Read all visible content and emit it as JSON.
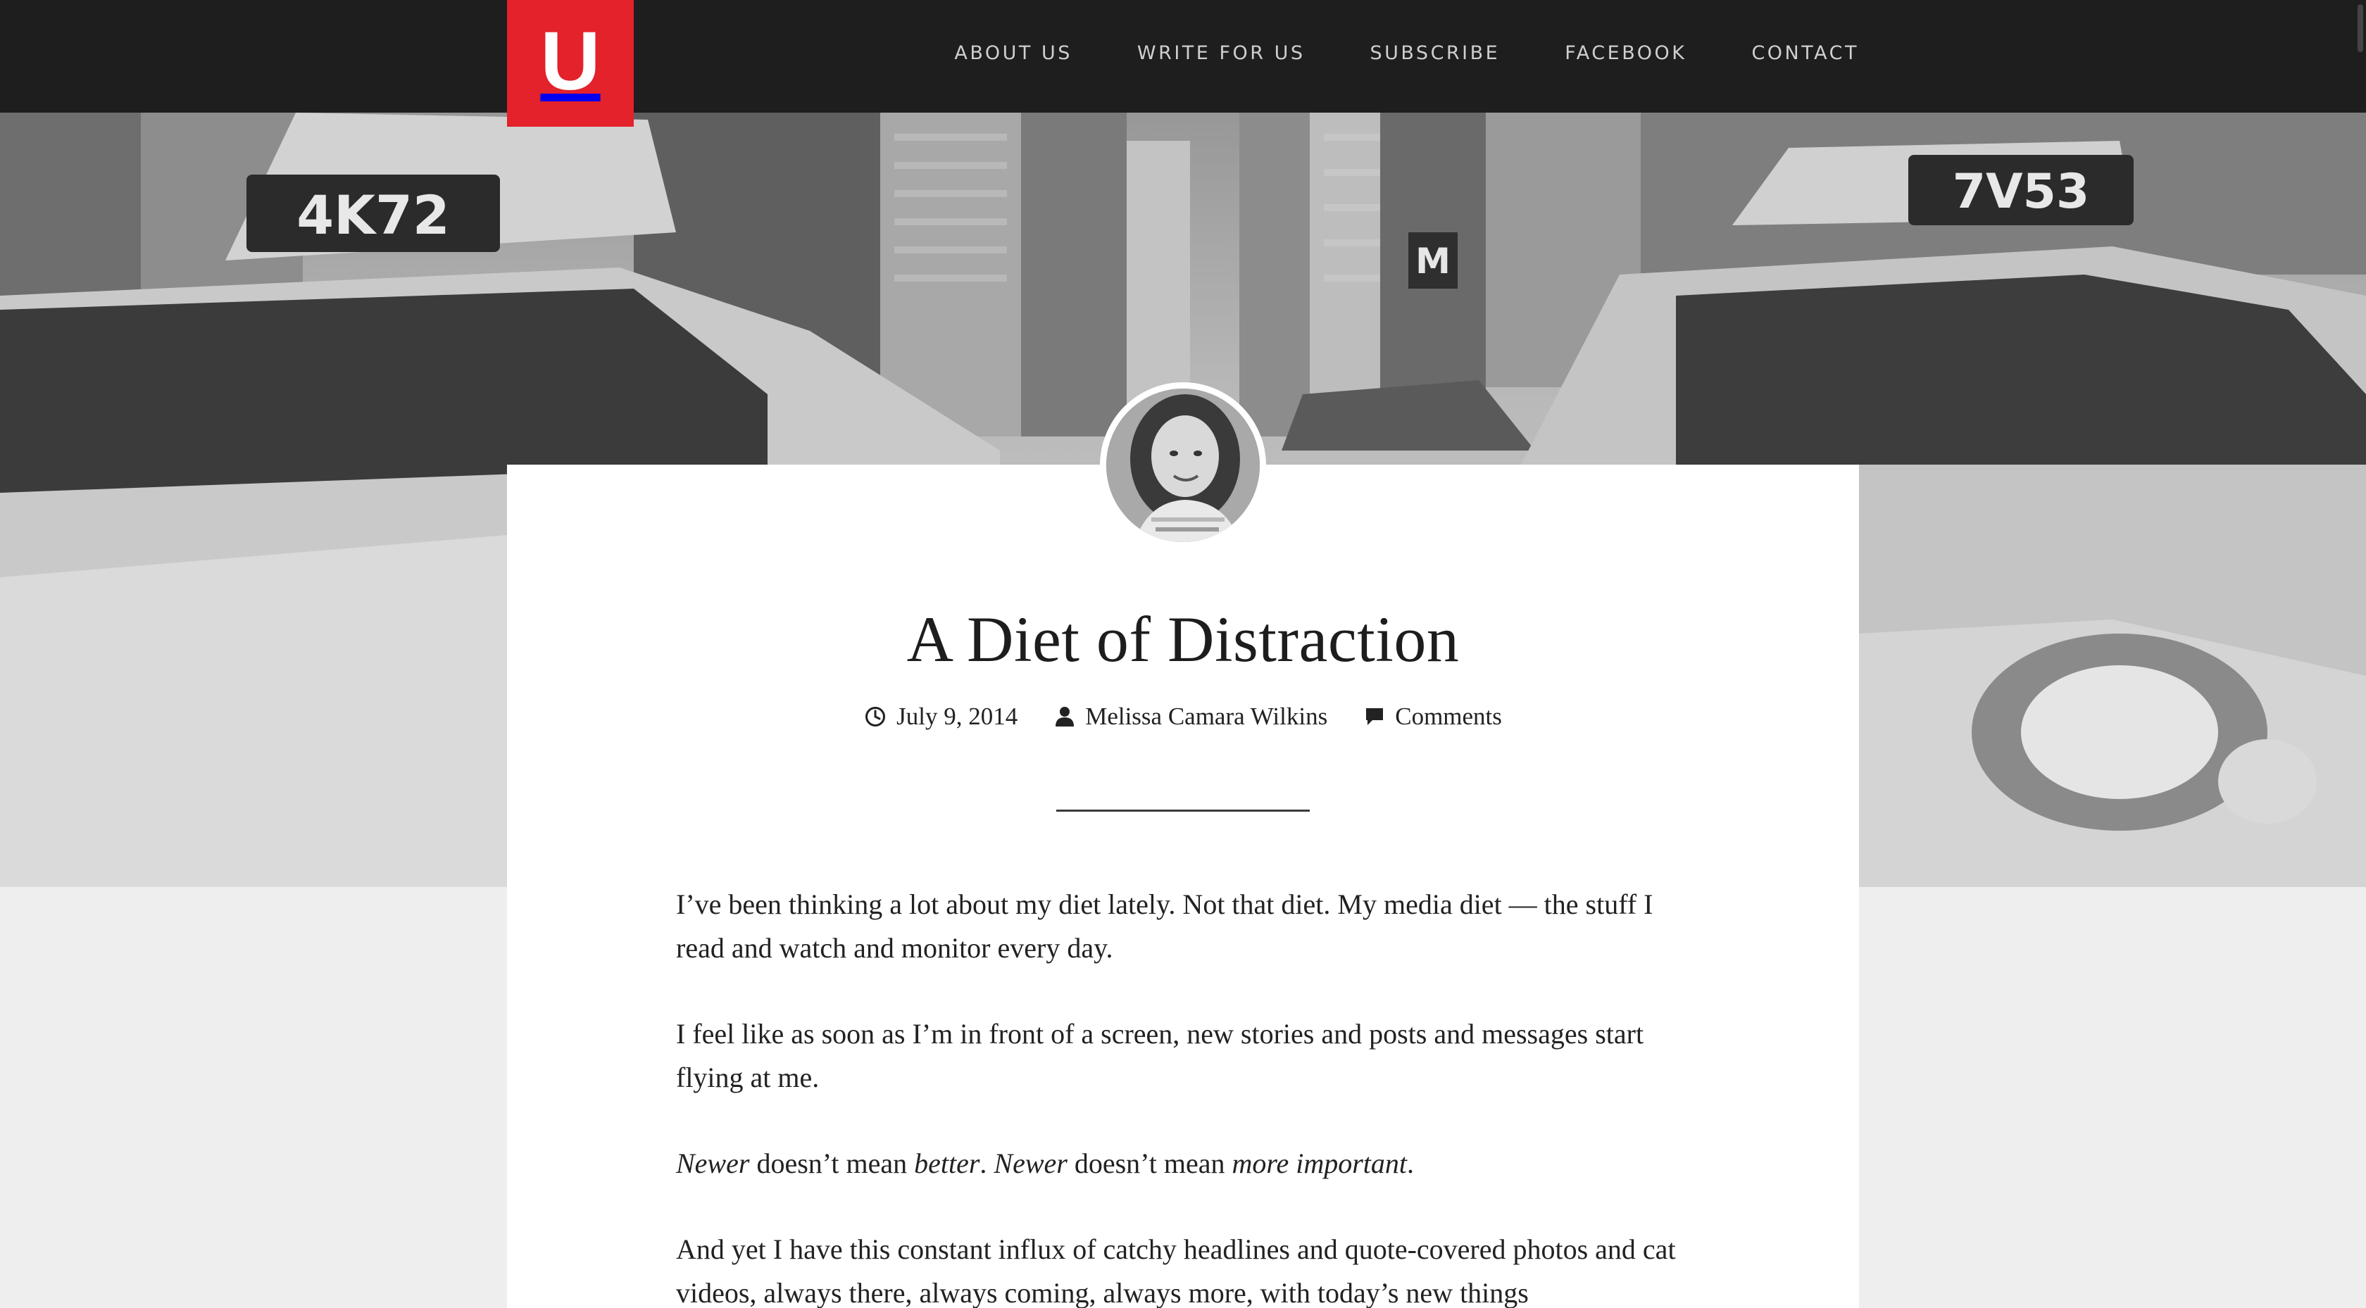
{
  "site": {
    "logo_letter": "U",
    "brand_color": "#e3222b",
    "topbar_color": "#1e1e1e"
  },
  "nav": {
    "items": [
      {
        "label": "ABOUT US"
      },
      {
        "label": "WRITE FOR US"
      },
      {
        "label": "SUBSCRIBE"
      },
      {
        "label": "FACEBOOK"
      },
      {
        "label": "CONTACT"
      }
    ]
  },
  "hero": {
    "plate_left": "4K72",
    "plate_right": "7V53",
    "sign": "M"
  },
  "article": {
    "title": "A Diet of Distraction",
    "date": "July 9, 2014",
    "date_icon": "clock-icon",
    "author": "Melissa Camara Wilkins",
    "author_icon": "user-icon",
    "comments": "Comments",
    "comments_icon": "comment-icon",
    "paragraphs": [
      "I’ve been thinking a lot about my diet lately. Not that diet. My media diet — the stuff I read and watch and monitor every day.",
      "I feel like as soon as I’m in front of a screen, new stories and posts and messages start flying at me."
    ],
    "p3": {
      "a": "Newer",
      "b": " doesn’t mean ",
      "c": "better",
      "d": ". ",
      "e": "Newer",
      "f": " doesn’t mean ",
      "g": "more important",
      "h": "."
    },
    "p4": "And yet I have this constant influx of catchy headlines and quote-covered photos and cat videos, always there, always coming, always more, with today’s new things"
  }
}
